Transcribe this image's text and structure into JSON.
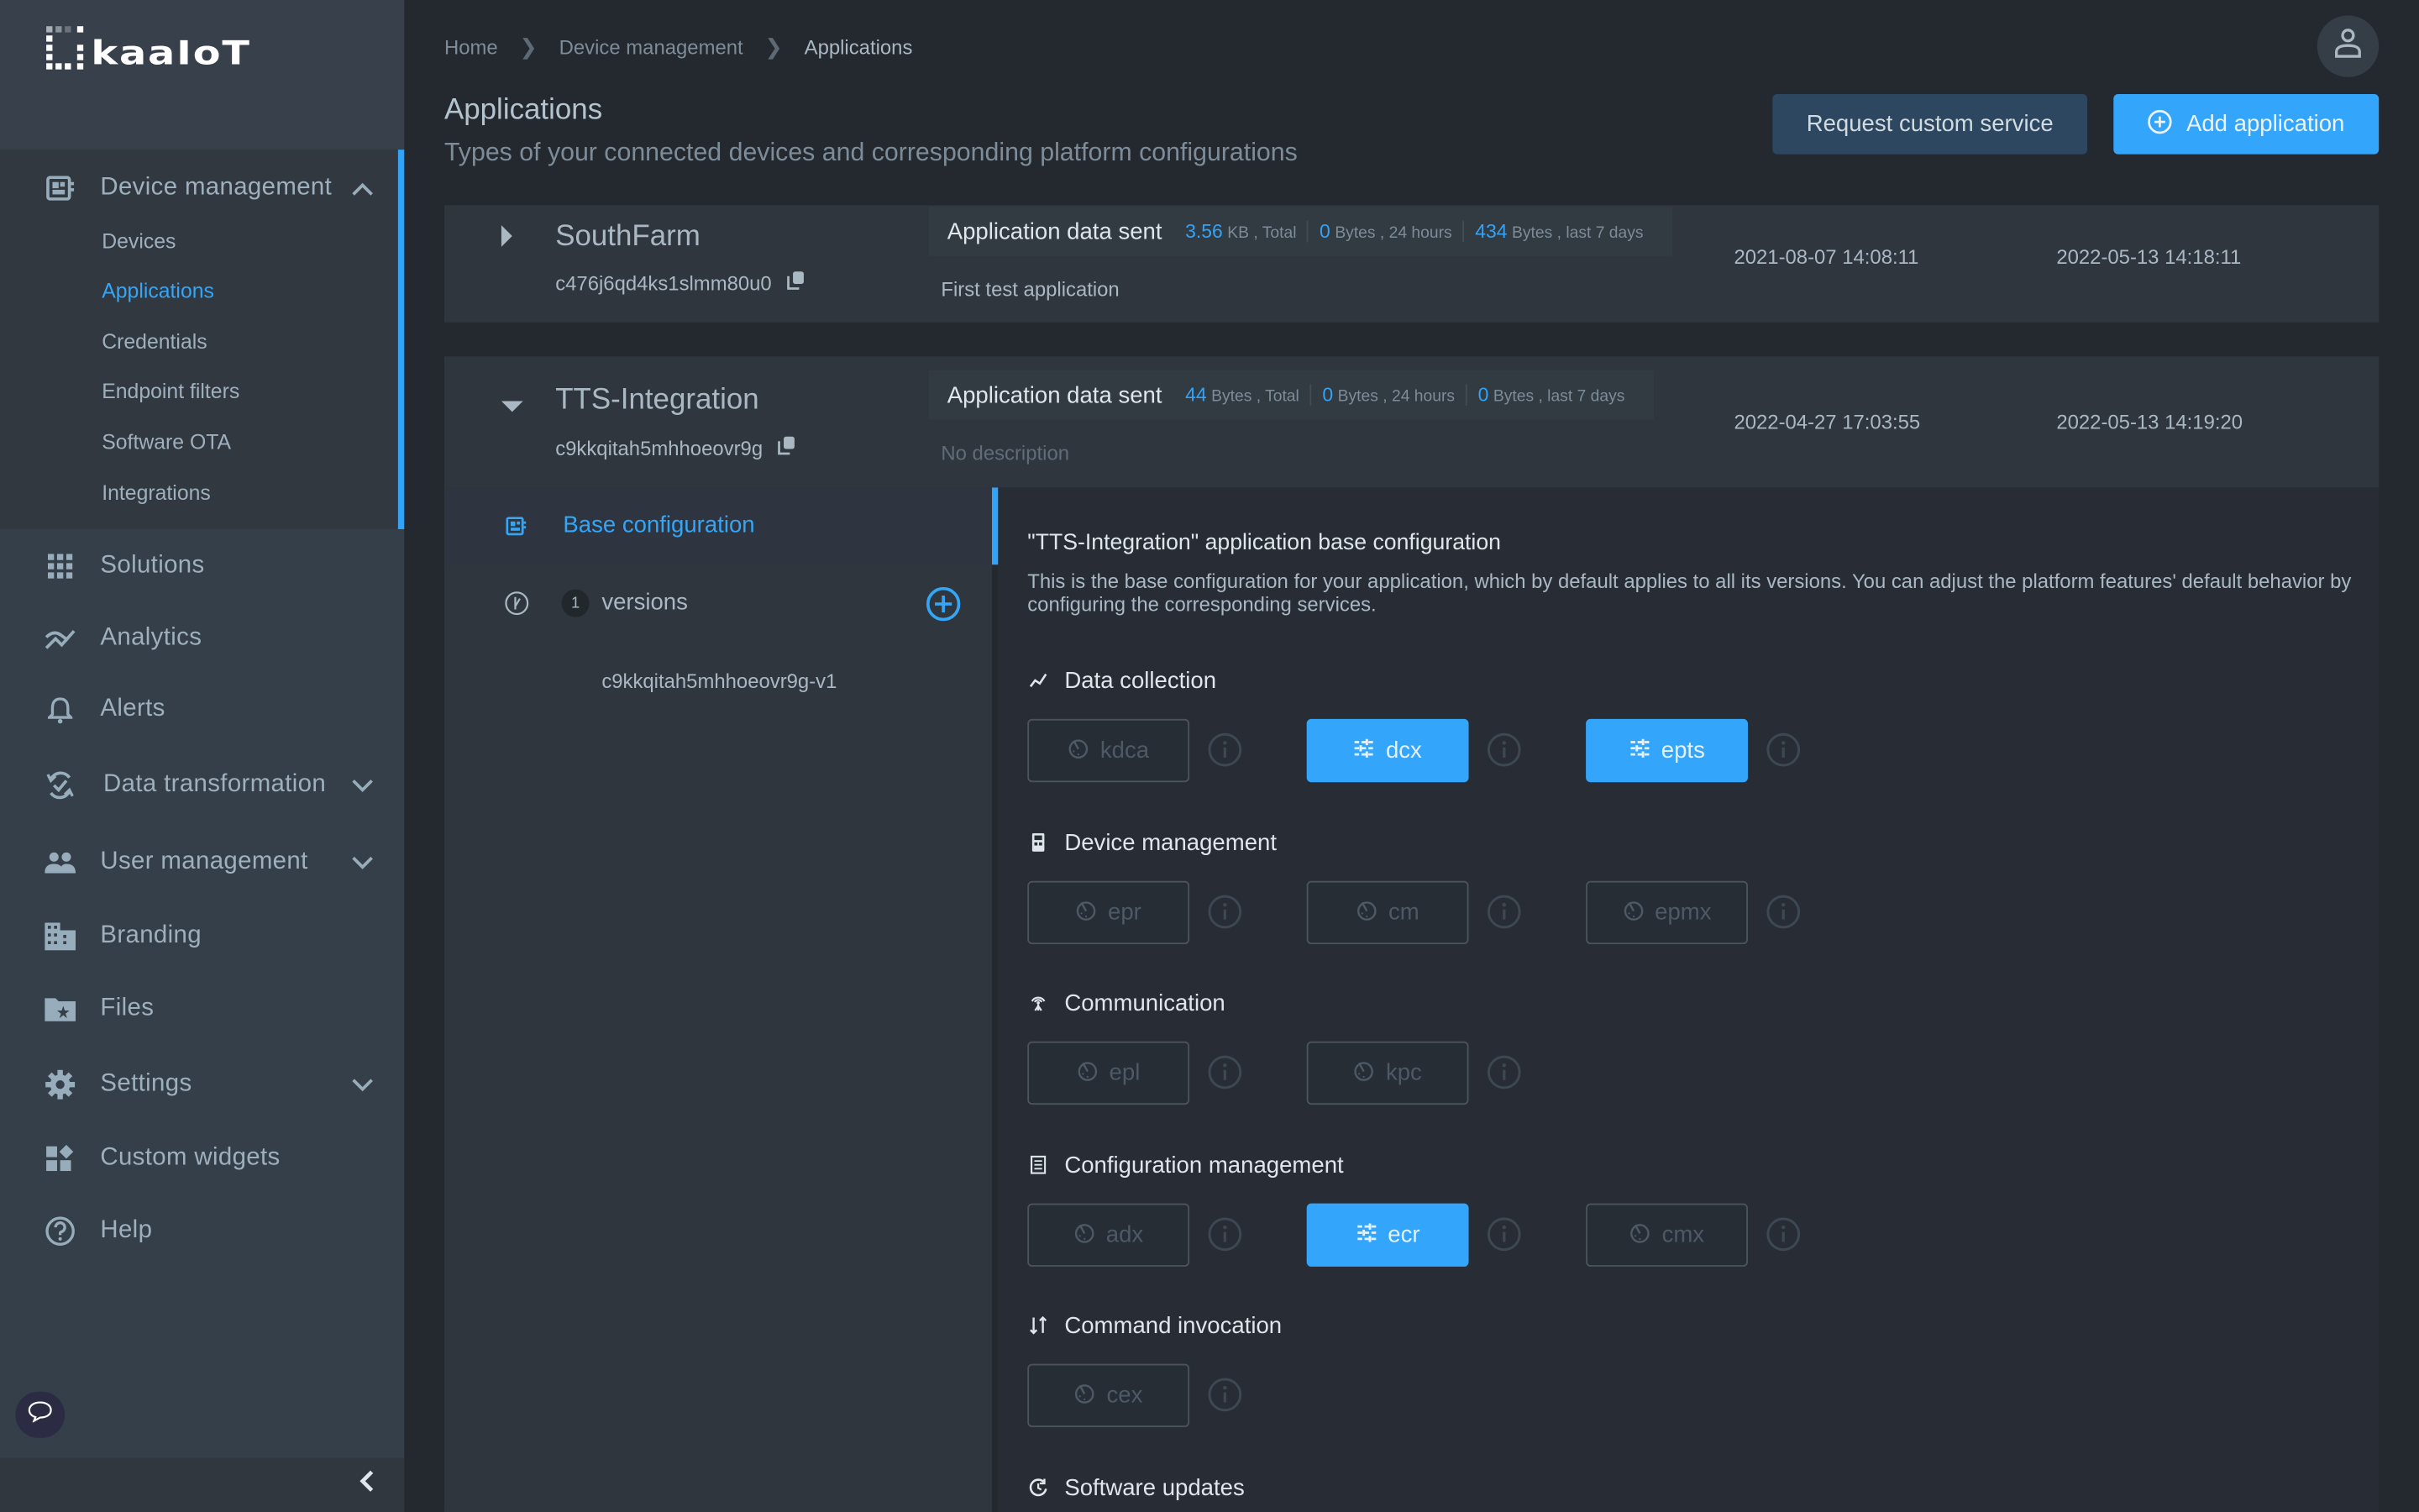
{
  "logo": {
    "text": "kaaIoT"
  },
  "sidebar": {
    "device_management": {
      "label": "Device management",
      "expanded": true,
      "children": [
        {
          "label": "Devices",
          "active": false
        },
        {
          "label": "Applications",
          "active": true
        },
        {
          "label": "Credentials",
          "active": false
        },
        {
          "label": "Endpoint filters",
          "active": false
        },
        {
          "label": "Software OTA",
          "active": false
        },
        {
          "label": "Integrations",
          "active": false
        }
      ]
    },
    "items": [
      {
        "label": "Solutions",
        "icon": "grid-icon"
      },
      {
        "label": "Analytics",
        "icon": "analytics-icon"
      },
      {
        "label": "Alerts",
        "icon": "bell-icon"
      },
      {
        "label": "Data transformation",
        "icon": "transform-icon",
        "expandable": true
      },
      {
        "label": "User management",
        "icon": "users-icon",
        "expandable": true
      },
      {
        "label": "Branding",
        "icon": "building-icon"
      },
      {
        "label": "Files",
        "icon": "folder-star-icon"
      },
      {
        "label": "Settings",
        "icon": "gear-icon",
        "expandable": true
      },
      {
        "label": "Custom widgets",
        "icon": "widgets-icon"
      },
      {
        "label": "Help",
        "icon": "help-icon"
      }
    ]
  },
  "breadcrumb": [
    "Home",
    "Device management",
    "Applications"
  ],
  "header": {
    "title": "Applications",
    "subtitle": "Types of your connected devices and corresponding platform configurations",
    "request_button": "Request custom service",
    "add_button": "Add application"
  },
  "applications": [
    {
      "name": "SouthFarm",
      "id": "c476j6qd4ks1slmm80u0",
      "expanded": false,
      "stats_title": "Application data sent",
      "stats": [
        {
          "value": "3.56",
          "unit": "KB , Total"
        },
        {
          "value": "0",
          "unit": "Bytes , 24 hours"
        },
        {
          "value": "434",
          "unit": "Bytes , last 7 days"
        }
      ],
      "description": "First test application",
      "created": "2021-08-07 14:08:11",
      "updated": "2022-05-13 14:18:11"
    },
    {
      "name": "TTS-Integration",
      "id": "c9kkqitah5mhhoeovr9g",
      "expanded": true,
      "stats_title": "Application data sent",
      "stats": [
        {
          "value": "44",
          "unit": "Bytes , Total"
        },
        {
          "value": "0",
          "unit": "Bytes , 24 hours"
        },
        {
          "value": "0",
          "unit": "Bytes , last 7 days"
        }
      ],
      "description": "No description",
      "created": "2022-04-27 17:03:55",
      "updated": "2022-05-13 14:19:20"
    }
  ],
  "expanded_app": {
    "base_config_label": "Base configuration",
    "versions_count": "1",
    "versions_label": "versions",
    "versions": [
      "c9kkqitah5mhhoeovr9g-v1"
    ],
    "config_title": "\"TTS-Integration\" application base configuration",
    "config_description": "This is the base configuration for your application, which by default applies to all its versions. You can adjust the platform features' default behavior by configuring the corresponding services.",
    "sections": [
      {
        "title": "Data collection",
        "icon": "chart-line-icon",
        "services": [
          {
            "name": "kdca",
            "enabled": false
          },
          {
            "name": "dcx",
            "enabled": true
          },
          {
            "name": "epts",
            "enabled": true
          }
        ]
      },
      {
        "title": "Device management",
        "icon": "device-icon",
        "services": [
          {
            "name": "epr",
            "enabled": false
          },
          {
            "name": "cm",
            "enabled": false
          },
          {
            "name": "epmx",
            "enabled": false
          }
        ]
      },
      {
        "title": "Communication",
        "icon": "antenna-icon",
        "services": [
          {
            "name": "epl",
            "enabled": false
          },
          {
            "name": "kpc",
            "enabled": false
          }
        ]
      },
      {
        "title": "Configuration management",
        "icon": "list-icon",
        "services": [
          {
            "name": "adx",
            "enabled": false
          },
          {
            "name": "ecr",
            "enabled": true
          },
          {
            "name": "cmx",
            "enabled": false
          }
        ]
      },
      {
        "title": "Command invocation",
        "icon": "swap-icon",
        "services": [
          {
            "name": "cex",
            "enabled": false
          }
        ]
      },
      {
        "title": "Software updates",
        "icon": "update-icon",
        "services": []
      }
    ]
  },
  "colors": {
    "accent": "#33a5fb",
    "sidebar": "#353f49",
    "background": "#24292f"
  }
}
